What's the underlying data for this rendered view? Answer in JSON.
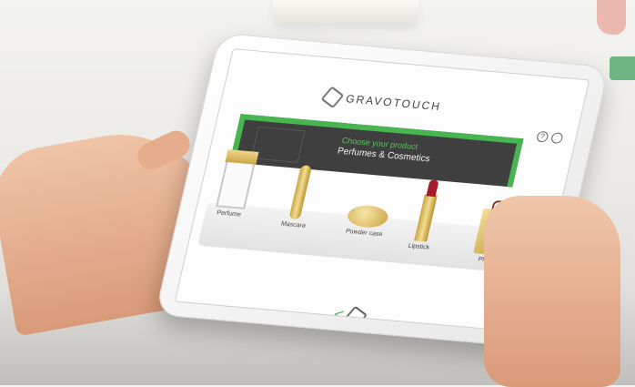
{
  "screen": {
    "brand": "GRAVOTOUCH",
    "banner": {
      "title": "Choose your product",
      "subtitle": "Perfumes & Cosmetics"
    },
    "help_icon": "?",
    "products": [
      {
        "label": "Perfume",
        "icon": "perfume-bottle"
      },
      {
        "label": "Mascara",
        "icon": "mascara"
      },
      {
        "label": "Powder case",
        "icon": "powder-jar"
      },
      {
        "label": "Lipstick",
        "icon": "lipstick"
      },
      {
        "label": "Plate",
        "icon": "plate"
      }
    ],
    "back_symbol": "<"
  },
  "colors": {
    "accent_green": "#47b550",
    "banner_dark": "#3f3f3f",
    "gold": "#d9b95c"
  }
}
